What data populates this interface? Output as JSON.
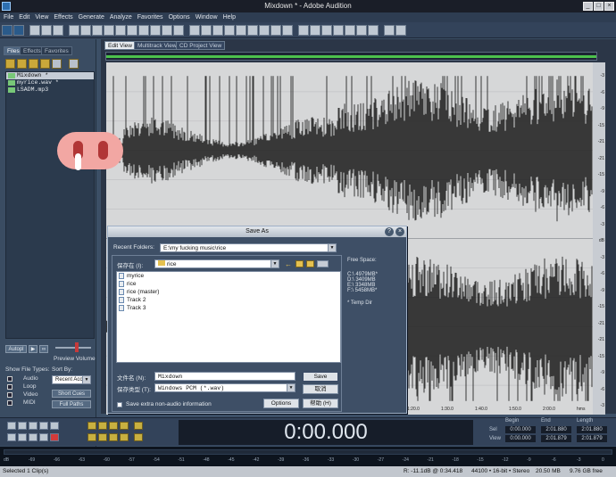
{
  "window": {
    "title": "Mixdown * - Adobe Audition",
    "controls": [
      "_",
      "□",
      "×"
    ]
  },
  "menu": [
    "File",
    "Edit",
    "View",
    "Effects",
    "Generate",
    "Analyze",
    "Favorites",
    "Options",
    "Window",
    "Help"
  ],
  "left_panel": {
    "tabs": [
      "Files",
      "Effects",
      "Favorites"
    ],
    "files": [
      {
        "name": "Mixdown *",
        "selected": true
      },
      {
        "name": "myrice.wav *",
        "selected": false
      },
      {
        "name": "LSADM.mp3",
        "selected": false
      }
    ],
    "auto_label": "Autopl",
    "preview_volume": "Preview Volume",
    "show_file_types": "Show File Types:",
    "sort_by": "Sort By:",
    "types": [
      "Audio",
      "Loop",
      "Video",
      "MIDI"
    ],
    "sort_value": "Recent Acc",
    "short_cues": "Short Cues",
    "full_paths": "Full Paths"
  },
  "editor": {
    "tabs": [
      "Edit View",
      "Multitrack View",
      "CD Project View"
    ],
    "active_tab": 0
  },
  "db_scale": [
    "-3",
    "-6",
    "-9",
    "-15",
    "-21",
    "-21",
    "-15",
    "-9",
    "-6",
    "-3",
    "dB",
    "-3",
    "-6",
    "-9",
    "-15",
    "-21",
    "-21",
    "-15",
    "-9",
    "-6",
    "-3"
  ],
  "timeline": [
    "1:20.0",
    "1:30.0",
    "1:40.0",
    "1:50.0",
    "2:00.0",
    "hms"
  ],
  "dialog": {
    "title": "Save As",
    "recent_label": "Recent Folders:",
    "recent_value": "E:\\my fucking music\\rice",
    "savein_label": "保存在 (I):",
    "savein_value": "rice",
    "folders": [
      "myrice",
      "rice",
      "rice (master)",
      "Track 2",
      "Track 3"
    ],
    "filename_label": "文件名 (N):",
    "filename_value": "Mixdown",
    "filetype_label": "保存类型 (T):",
    "filetype_value": "Windows PCM (*.wav)",
    "save_btn": "Save",
    "cancel_btn": "取消",
    "options_btn": "Options",
    "help_btn": "帮助 (H)",
    "extra_checkbox": "Save extra non-audio information",
    "free_space_title": "Free Space:",
    "drives": [
      "C:\\   4979MB*",
      "D:\\   3409MB",
      "E:\\   3348MB",
      "F:\\   5458MB*"
    ],
    "temp_note": "* Temp Dir"
  },
  "transport": {
    "timecode": "0:00.000",
    "headers": [
      "Begin",
      "End",
      "Length"
    ],
    "sel_label": "Sel",
    "view_label": "View",
    "sel": [
      "0:00.000",
      "2:01.880",
      "2:01.880"
    ],
    "view": [
      "0:00.000",
      "2:01.879",
      "2:01.879"
    ]
  },
  "level_scale": [
    "dB",
    "-69",
    "-66",
    "-63",
    "-60",
    "-57",
    "-54",
    "-51",
    "-48",
    "-45",
    "-42",
    "-39",
    "-36",
    "-33",
    "-30",
    "-27",
    "-24",
    "-21",
    "-18",
    "-15",
    "-12",
    "-9",
    "-6",
    "-3",
    "0"
  ],
  "status": {
    "left": "Selected 1 Clip(s)",
    "level": "R: -11.1dB @ 0:34.418",
    "format": "44100 • 16-bit • Stereo",
    "size": "20.50 MB",
    "free": "9.76 GB free"
  }
}
